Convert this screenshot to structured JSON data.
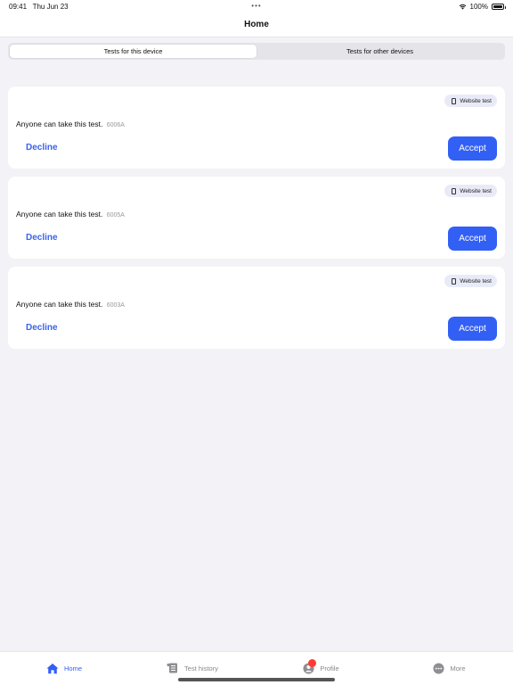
{
  "status": {
    "time": "09:41",
    "date": "Thu Jun 23",
    "battery": "100%"
  },
  "nav": {
    "title": "Home"
  },
  "segments": [
    {
      "label": "Tests for this device",
      "active": true
    },
    {
      "label": "Tests for other devices",
      "active": false
    }
  ],
  "cards": [
    {
      "badge": "Website test",
      "text": "Anyone can take this test.",
      "code": "6006A",
      "decline": "Decline",
      "accept": "Accept"
    },
    {
      "badge": "Website test",
      "text": "Anyone can take this test.",
      "code": "6005A",
      "decline": "Decline",
      "accept": "Accept"
    },
    {
      "badge": "Website test",
      "text": "Anyone can take this test.",
      "code": "6003A",
      "decline": "Decline",
      "accept": "Accept"
    }
  ],
  "tabs": [
    {
      "label": "Home",
      "icon": "house-icon",
      "active": true
    },
    {
      "label": "Test history",
      "icon": "document-icon",
      "active": false
    },
    {
      "label": "Profile",
      "icon": "person-icon",
      "active": false,
      "notification": true
    },
    {
      "label": "More",
      "icon": "ellipsis-icon",
      "active": false
    }
  ],
  "colors": {
    "accent": "#3260f5",
    "background": "#f2f2f7",
    "notification": "#ff3b30"
  }
}
